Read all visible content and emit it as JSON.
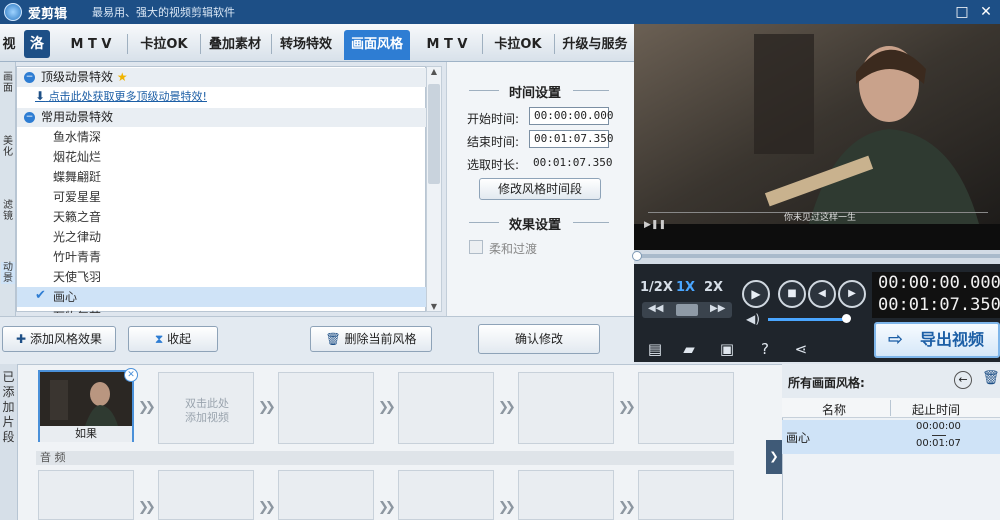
{
  "app": {
    "name": "爱剪辑",
    "slogan": "最易用、强大的视频剪辑软件"
  },
  "window": {
    "maximize_icon": "□",
    "close_icon": "✕"
  },
  "tabs": [
    {
      "label": "视"
    },
    {
      "label": "M T V"
    },
    {
      "label": "卡拉OK"
    },
    {
      "label": "叠加素材"
    },
    {
      "label": "转场特效"
    },
    {
      "label": "画面风格",
      "active": true
    },
    {
      "label": "M T V"
    },
    {
      "label": "卡拉OK"
    },
    {
      "label": "升级与服务"
    }
  ],
  "side_tabs": [
    "画面",
    "美化",
    "滤镜",
    "动景"
  ],
  "effects": {
    "top_group": {
      "label": "顶级动景特效",
      "link": "点击此处获取更多顶级动景特效!"
    },
    "common_group": {
      "label": "常用动景特效"
    },
    "items": [
      "鱼水情深",
      "烟花灿烂",
      "蝶舞翩跹",
      "可爱星星",
      "天籁之音",
      "光之律动",
      "竹叶青青",
      "天使飞羽",
      "画心",
      "万物复苏"
    ],
    "selected": "画心"
  },
  "time_settings": {
    "title": "时间设置",
    "start_label": "开始时间:",
    "start_value": "00:00:00.000",
    "end_label": "结束时间:",
    "end_value": "00:01:07.350",
    "duration_label": "选取时长:",
    "duration_value": "00:01:07.350",
    "modify_button": "修改风格时间段"
  },
  "effect_settings": {
    "title": "效果设置",
    "soft_transition": "柔和过渡"
  },
  "toolbar": {
    "add_effect": "添加风格效果",
    "collapse": "收起",
    "delete_current": "删除当前风格",
    "confirm": "确认修改"
  },
  "player": {
    "subtitle": "你未见过这样一生",
    "speeds": [
      "1/2X",
      "1X",
      "2X"
    ],
    "current_time": "00:00:00.000",
    "total_time": "00:01:07.350",
    "export_button": "导出视频"
  },
  "clips": {
    "panel_label": "已添加片段",
    "first_clip_name": "如果",
    "empty_hint_line1": "双击此处",
    "empty_hint_line2": "添加视频",
    "audio_label": "音 频"
  },
  "styles_panel": {
    "title": "所有画面风格:",
    "col_name": "名称",
    "col_time": "起止时间",
    "row_name": "画心",
    "row_start": "00:00:00",
    "row_end": "00:01:07"
  },
  "colors": {
    "accent": "#2e7dd3",
    "titlebar": "#1d4f86"
  }
}
